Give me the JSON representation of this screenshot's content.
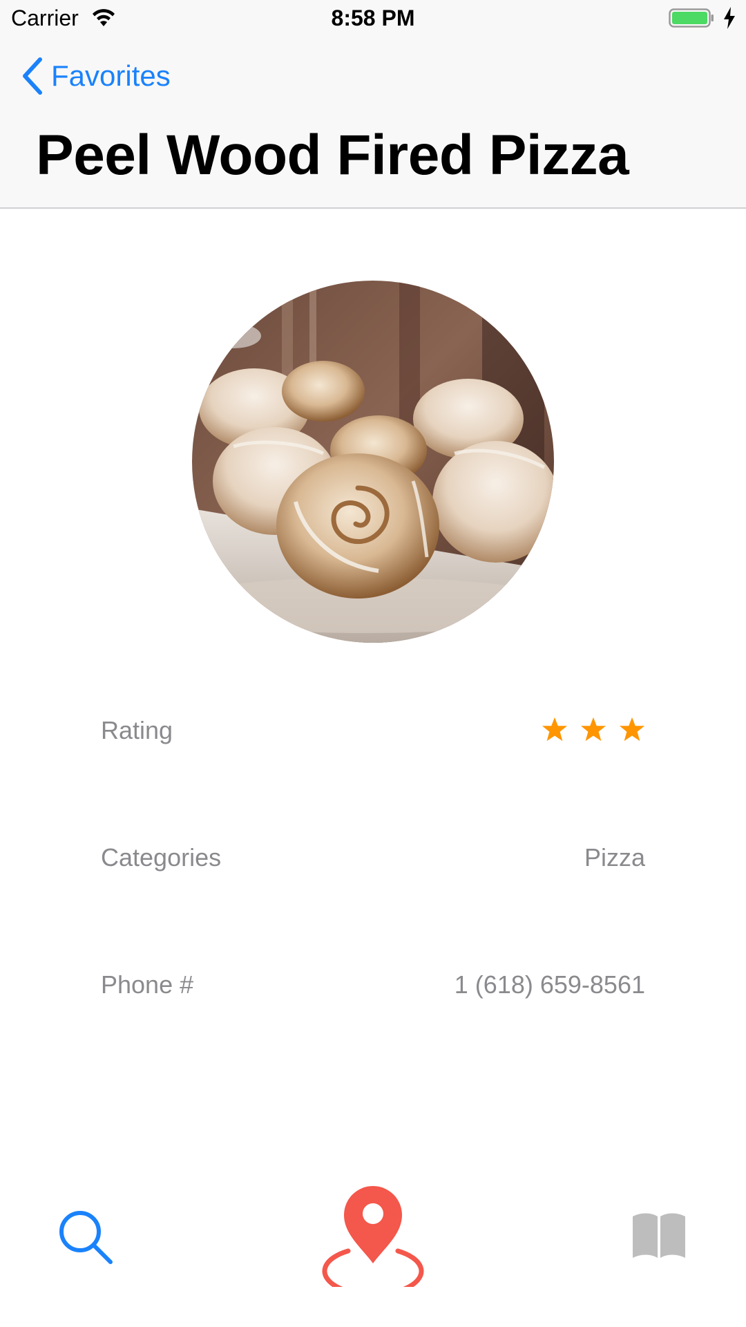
{
  "status_bar": {
    "carrier": "Carrier",
    "time": "8:58 PM"
  },
  "nav": {
    "back_label": "Favorites",
    "title": "Peel Wood Fired Pizza"
  },
  "details": {
    "rating": {
      "label": "Rating",
      "stars": 3
    },
    "categories": {
      "label": "Categories",
      "value": "Pizza"
    },
    "phone": {
      "label": "Phone #",
      "value": "1 (618) 659-8561"
    }
  },
  "tab_bar": {
    "items": [
      {
        "icon": "search-icon",
        "active": true
      },
      {
        "icon": "map-pin-icon",
        "active": false
      },
      {
        "icon": "book-icon",
        "active": false
      }
    ]
  },
  "colors": {
    "accent": "#1a82fb",
    "star": "#ff9500",
    "pin": "#f4574b",
    "inactive": "#bdbdbd",
    "label": "#8a8a8e"
  }
}
